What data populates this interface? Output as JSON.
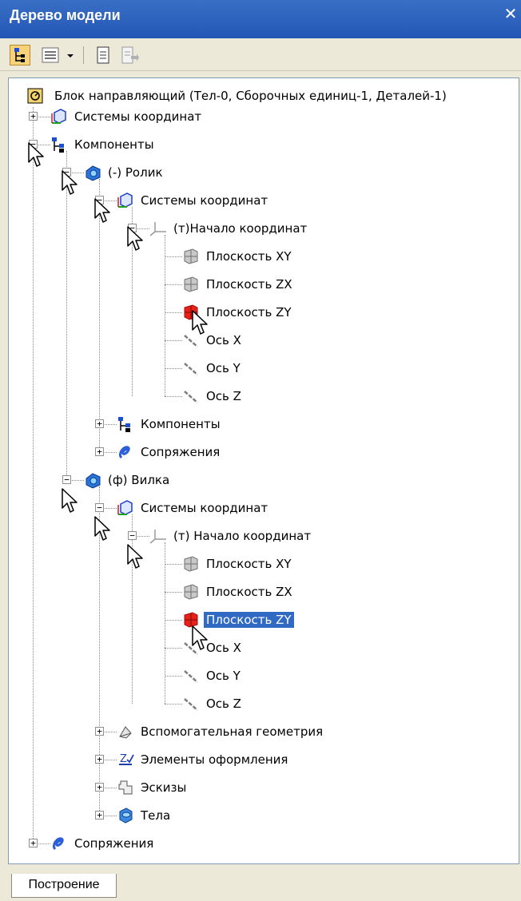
{
  "window": {
    "title": "Дерево модели",
    "close_symbol": "✕"
  },
  "toolbar": {
    "buttons": [
      {
        "icon": "tree-view-icon"
      },
      {
        "icon": "list-view-icon"
      },
      {
        "icon": "dropdown-arrow-icon"
      },
      {
        "icon": "document-icon"
      },
      {
        "icon": "document-export-icon"
      }
    ]
  },
  "tree": {
    "root": "Блок направляющий (Тел-0, Сборочных единиц-1, Деталей-1)",
    "items": [
      {
        "label": "Системы координат",
        "icon": "coordinate-system-icon",
        "expander": "+"
      },
      {
        "label": "Компоненты",
        "icon": "components-icon",
        "expander": "−"
      },
      {
        "label": "(-) Ролик",
        "icon": "part-icon",
        "expander": "−"
      },
      {
        "label": "Системы координат",
        "icon": "coordinate-system-icon",
        "expander": "−"
      },
      {
        "label": "(т)Начало координат",
        "icon": "origin-icon",
        "expander": "−"
      },
      {
        "label": "Плоскость XY",
        "icon": "plane-icon"
      },
      {
        "label": "Плоскость ZX",
        "icon": "plane-icon"
      },
      {
        "label": "Плоскость ZY",
        "icon": "plane-red-icon"
      },
      {
        "label": "Ось X",
        "icon": "axis-icon"
      },
      {
        "label": "Ось Y",
        "icon": "axis-icon"
      },
      {
        "label": "Ось Z",
        "icon": "axis-icon"
      },
      {
        "label": "Компоненты",
        "icon": "components-icon",
        "expander": "+"
      },
      {
        "label": "Сопряжения",
        "icon": "mates-icon",
        "expander": "+"
      },
      {
        "label": "(ф) Вилка",
        "icon": "part-icon",
        "expander": "−"
      },
      {
        "label": "Системы координат",
        "icon": "coordinate-system-icon",
        "expander": "−"
      },
      {
        "label": "(т) Начало координат",
        "icon": "origin-icon",
        "expander": "−"
      },
      {
        "label": "Плоскость XY",
        "icon": "plane-icon"
      },
      {
        "label": "Плоскость ZX",
        "icon": "plane-icon"
      },
      {
        "label": "Плоскость ZY",
        "icon": "plane-red-icon",
        "selected": true
      },
      {
        "label": "Ось X",
        "icon": "axis-icon"
      },
      {
        "label": "Ось Y",
        "icon": "axis-icon"
      },
      {
        "label": "Ось Z",
        "icon": "axis-icon"
      },
      {
        "label": "Вспомогательная геометрия",
        "icon": "auxiliary-geometry-icon",
        "expander": "+"
      },
      {
        "label": "Элементы оформления",
        "icon": "annotation-elements-icon",
        "expander": "+"
      },
      {
        "label": "Эскизы",
        "icon": "sketches-icon",
        "expander": "+"
      },
      {
        "label": "Тела",
        "icon": "bodies-icon",
        "expander": "+"
      },
      {
        "label": "Сопряжения",
        "icon": "mates-icon",
        "expander": "+"
      }
    ]
  },
  "tabs": {
    "active": "Построение"
  },
  "colors": {
    "title_bar": "#2a5db5",
    "selection": "#316ac5",
    "plane_highlight": "#e8201a"
  }
}
